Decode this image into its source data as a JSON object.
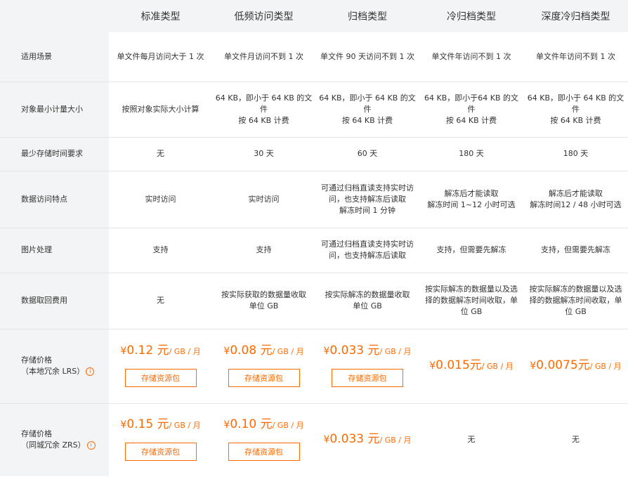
{
  "header": [
    "",
    "标准类型",
    "低频访问类型",
    "归档类型",
    "冷归档类型",
    "深度冷归档类型"
  ],
  "rows": [
    {
      "label": "适用场景",
      "cells": [
        "单文件每月访问大于 1 次",
        "单文件月访问不到 1 次",
        "单文件 90 天访问不到 1 次",
        "单文件年访问不到 1 次",
        "单文件年访问不到 1 次"
      ]
    },
    {
      "label": "对象最小计量大小",
      "cells": [
        "按照对象实际大小计算",
        "64 KB，即小于 64 KB 的文件\n按 64 KB 计费",
        "64 KB，即小于 64 KB 的文件\n按 64 KB 计费",
        "64 KB，即小于64 KB 的文件\n按 64 KB 计费",
        "64 KB，即小于 64 KB 的文件\n按 64 KB 计费"
      ]
    },
    {
      "label": "最少存储时间要求",
      "cells": [
        "无",
        "30 天",
        "60 天",
        "180 天",
        "180 天"
      ]
    },
    {
      "label": "数据访问特点",
      "cells": [
        "实时访问",
        "实时访问",
        "可通过归档直读支持实时访问，也支持解冻后读取\n解冻时间 1 分钟",
        "解冻后才能读取\n解冻时间 1~12 小时可选",
        "解冻后才能读取\n解冻时间12 / 48 小时可选"
      ]
    },
    {
      "label": "图片处理",
      "cells": [
        "支持",
        "支持",
        "可通过归档直读支持实时访问，也支持解冻后读取",
        "支持，但需要先解冻",
        "支持，但需要先解冻"
      ]
    },
    {
      "label": "数据取回费用",
      "cells": [
        "无",
        "按实际获取的数据量收取\n单位 GB",
        "按实际解冻的数据量收取\n单位 GB",
        "按实际解冻的数据量以及选择的数据解冻时间收取，单位 GB",
        "按实际解冻的数据量以及选择的数据解冻时间收取，单位 GB"
      ]
    }
  ],
  "lrs": {
    "label1": "存储价格",
    "label2": "（本地冗余 LRS）",
    "info": "i",
    "currency": "¥",
    "unit": "/ GB / 月",
    "pkg": "存储资源包",
    "p1": "0.12 元",
    "p2": "0.08 元",
    "p3": "0.033 元",
    "p4": "0.015元",
    "p5": "0.0075元"
  },
  "zrs": {
    "label1": "存储价格",
    "label2": "（同城冗余 ZRS）",
    "info": "i",
    "currency": "¥",
    "unit": "/ GB / 月",
    "pkg": "存储资源包",
    "p1": "0.15 元",
    "p2": "0.10 元",
    "p3": "0.033 元",
    "c4": "无",
    "c5": "无"
  },
  "colors": {
    "accent": "#ff6a00",
    "labelBg": "#f3f4f5",
    "border": "#e6e6e6"
  }
}
